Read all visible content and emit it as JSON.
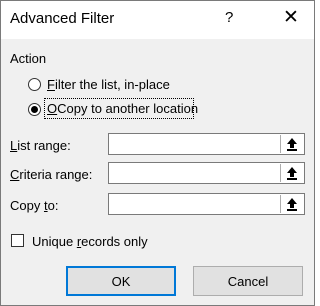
{
  "window": {
    "title": "Advanced Filter",
    "help_symbol": "?",
    "close_symbol": "✕"
  },
  "action": {
    "label": "Action",
    "options": [
      {
        "label_access": "F",
        "label_rest": "ilter the list, in-place",
        "selected": false
      },
      {
        "label_access": "O",
        "label_rest": "Copy to another location",
        "selected": true
      }
    ]
  },
  "fields": {
    "list_range": {
      "label_access": "L",
      "label_rest": "ist range:",
      "value": ""
    },
    "criteria_range": {
      "label_access": "C",
      "label_rest": "riteria range:",
      "value": ""
    },
    "copy_to": {
      "label_pre": "Copy ",
      "label_access": "t",
      "label_rest": "o:",
      "value": ""
    }
  },
  "unique_records": {
    "label_pre": "Unique ",
    "label_access": "r",
    "label_rest": "ecords only",
    "checked": false
  },
  "buttons": {
    "ok": "OK",
    "cancel": "Cancel"
  },
  "icons": {
    "collapse_dialog": "collapse-dialog-icon"
  }
}
